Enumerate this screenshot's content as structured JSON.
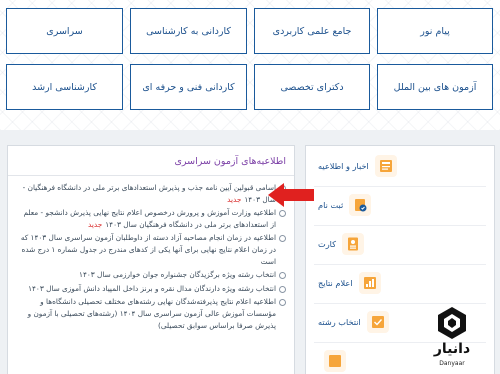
{
  "categories": {
    "row1": [
      "پیام نور",
      "جامع علمی کاربردی",
      "کاردانی به کارشناسی",
      "سراسری"
    ],
    "row2": [
      "آزمون های بین الملل",
      "دکترای تخصصی",
      "کاردانی فنی و حرفه ای",
      "کارشناسی ارشد"
    ]
  },
  "main": {
    "title": "اطلاعیه‌های آزمون سراسری",
    "news": [
      {
        "text": "اسامی قبولین آیین نامه جذب و پذیرش استعدادهای برتر ملی در دانشگاه فرهنگیان - سال ۱۴۰۳",
        "badge": "جدید"
      },
      {
        "text": "اطلاعیه وزارت آموزش و پرورش درخصوص اعلام نتایج نهایی پذیرش دانشجو - معلم از استعدادهای برتر ملی در دانشگاه فرهنگیان سال ۱۴۰۳",
        "badge": "جدید"
      },
      {
        "text": "اطلاعیه در زمان انجام مصاحبه آزاد دسته از داوطلبان آزمون سراسری سال ۱۴۰۳ که در زمان اعلام نتایج نهایی برای آنها یکی از کدهای مندرج در جدول شماره ۱ درج شده است",
        "badge": ""
      },
      {
        "text": "انتخاب رشته ویژه برگزیدگان جشنواره جوان خوارزمی سال ۱۴۰۳",
        "badge": ""
      },
      {
        "text": "انتخاب رشته ویژه دارندگان مدال نقره و برنز داخل المپیاد دانش آموزی سال ۱۴۰۳",
        "badge": ""
      },
      {
        "text": "اطلاعیه اعلام نتایج پذیرفته‌شدگان نهایی رشته‌های مختلف تحصیلی دانشگاه‌ها و مؤسسات آموزش عالی آزمون سراسری سال ۱۴۰۴ (رشته‌های تحصیلی با آزمون و پذیرش صرفا براساس سوابق تحصیلی)",
        "badge": ""
      }
    ]
  },
  "sidebar": {
    "items": [
      {
        "label": "اخبار و اطلاعیه",
        "icon": "news-icon"
      },
      {
        "label": "ثبت نام",
        "icon": "register-icon"
      },
      {
        "label": "کارت",
        "icon": "card-icon"
      },
      {
        "label": "اعلام نتایج",
        "icon": "results-icon"
      },
      {
        "label": "انتخاب رشته",
        "icon": "selection-icon"
      },
      {
        "label": "",
        "icon": "extra-icon"
      }
    ]
  },
  "logo": {
    "name": "دانیار",
    "latin": "Danyaar"
  },
  "colors": {
    "accent": "#1a5a9c",
    "title": "#7b3fa6",
    "badge": "#d92a2a",
    "arrow": "#e0211f"
  }
}
